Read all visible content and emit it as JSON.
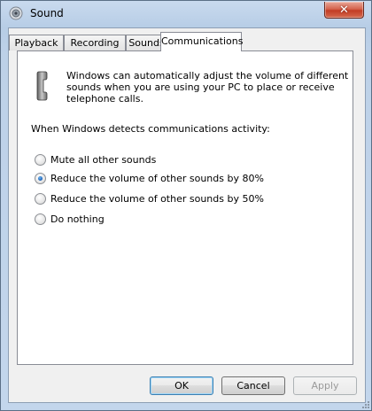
{
  "window": {
    "title": "Sound",
    "close_glyph": "✕"
  },
  "tabs": [
    {
      "label": "Playback",
      "active": false
    },
    {
      "label": "Recording",
      "active": false
    },
    {
      "label": "Sounds",
      "active": false
    },
    {
      "label": "Communications",
      "active": true
    }
  ],
  "communications": {
    "icon": "telephone-icon",
    "description": "Windows can automatically adjust the volume of different sounds when you are using your PC to place or receive telephone calls.",
    "prompt": "When Windows detects communications activity:",
    "options": [
      {
        "label": "Mute all other sounds",
        "checked": false
      },
      {
        "label": "Reduce the volume of other sounds by 80%",
        "checked": true
      },
      {
        "label": "Reduce the volume of other sounds by 50%",
        "checked": false
      },
      {
        "label": "Do nothing",
        "checked": false
      }
    ]
  },
  "buttons": {
    "ok": "OK",
    "cancel": "Cancel",
    "apply": "Apply"
  },
  "colors": {
    "title_bar": "#bdd1e8",
    "close_button": "#c23c24",
    "radio_selected": "#1a5fb4"
  }
}
